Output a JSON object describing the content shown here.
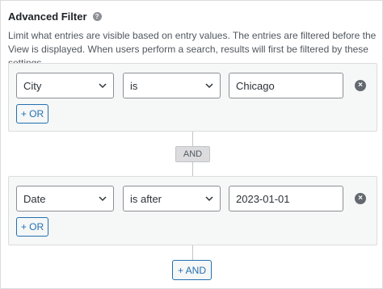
{
  "header": {
    "title": "Advanced Filter",
    "help_icon": "question-circle-icon",
    "description": "Limit what entries are visible based on entry values. The entries are filtered before the View is displayed. When users perform a search, results will first be filtered by these settings."
  },
  "groups": [
    {
      "field": "City",
      "operator": "is",
      "value": "Chicago",
      "or_label": "+ OR",
      "remove_icon": "remove-circle-icon"
    },
    {
      "field": "Date",
      "operator": "is after",
      "value": "2023-01-01",
      "or_label": "+ OR",
      "remove_icon": "remove-circle-icon"
    }
  ],
  "connector_label": "AND",
  "add_and_label": "+ AND",
  "colors": {
    "accent": "#2271b1",
    "group_bg": "#f6f7f7",
    "border": "#dcdcde",
    "remove_icon": "#646970"
  }
}
